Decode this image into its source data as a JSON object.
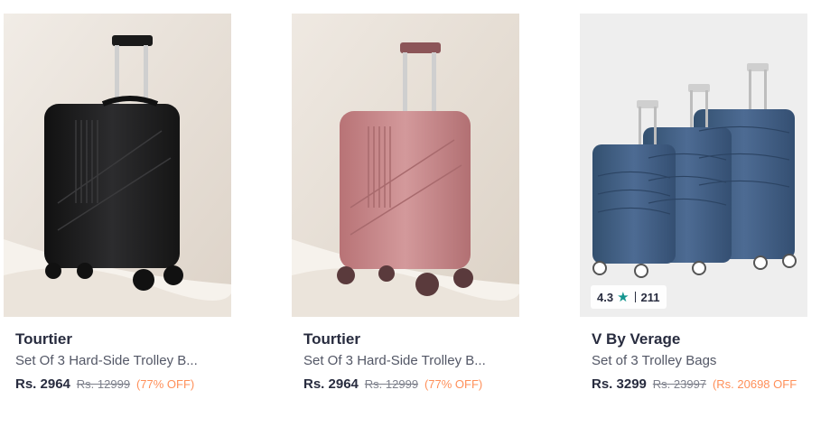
{
  "products": [
    {
      "brand": "Tourtier",
      "name": "Set Of 3 Hard-Side Trolley B...",
      "price": "Rs. 2964",
      "mrp": "Rs. 12999",
      "discount": "(77% OFF)",
      "color": "#1c1c1e"
    },
    {
      "brand": "Tourtier",
      "name": "Set Of 3 Hard-Side Trolley B...",
      "price": "Rs. 2964",
      "mrp": "Rs. 12999",
      "discount": "(77% OFF)",
      "color": "#c98486"
    },
    {
      "brand": "V By Verage",
      "name": "Set of 3 Trolley Bags",
      "price": "Rs. 3299",
      "mrp": "Rs. 23997",
      "discount": "(Rs. 20698 OFF",
      "color": "#3e5a80",
      "rating": {
        "value": "4.3",
        "count": "211",
        "icon": "star-icon"
      }
    }
  ],
  "colors": {
    "discount": "#ff905a",
    "rating_star": "#14958f"
  }
}
